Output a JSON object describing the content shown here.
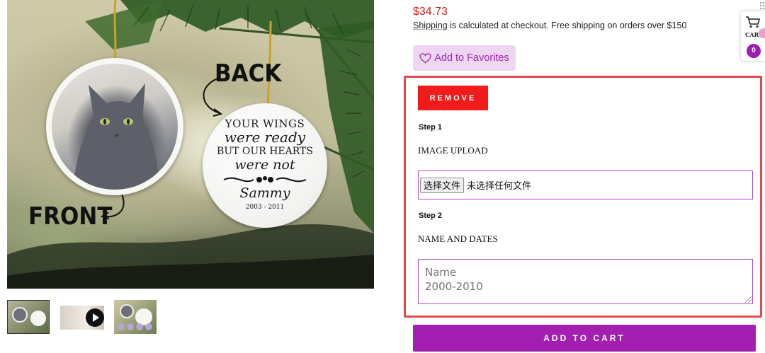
{
  "product_image": {
    "back_label": "BACK",
    "front_label": "FRONT",
    "ornament_text": {
      "line1": "YOUR WINGS",
      "line2": "were ready",
      "line3": "BUT OUR HEARTS",
      "line4": "were not",
      "line5": "Sammy",
      "line6": "2003 - 2011"
    }
  },
  "thumbnails": [
    {
      "name": "thumbnail-front-back"
    },
    {
      "name": "thumbnail-video"
    },
    {
      "name": "thumbnail-variants"
    }
  ],
  "product": {
    "price": "$34.73",
    "shipping_link": "Shipping",
    "shipping_text": " is calculated at checkout. Free shipping on orders over $150",
    "favorites_label": "Add to Favorites"
  },
  "customizer": {
    "remove_label": "REMOVE",
    "step1_label": "Step 1",
    "step1_field": "IMAGE UPLOAD",
    "file_button": "选择文件",
    "file_status": "未选择任何文件",
    "step2_label": "Step 2",
    "step2_field": "NAME AND DATES",
    "name_placeholder": "Name\n2000-2010"
  },
  "add_to_cart_label": "ADD TO CART",
  "cart": {
    "label": "CART",
    "count": "0"
  },
  "colors": {
    "price_red": "#d11b1b",
    "accent_purple": "#a21fb1",
    "remove_red": "#f01b1b",
    "box_outline": "#e8484b"
  }
}
